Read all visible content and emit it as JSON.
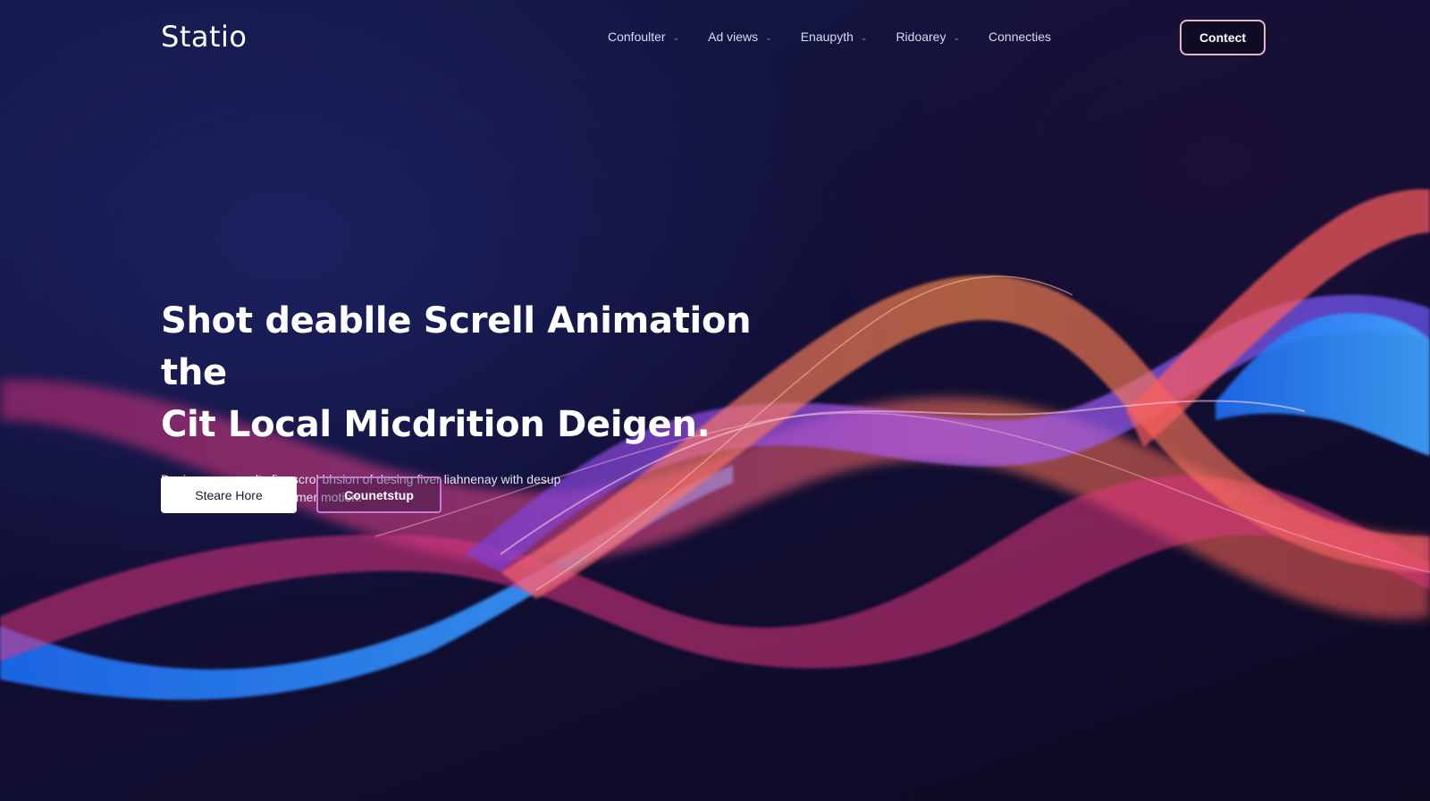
{
  "brand": {
    "logo_text": "Statio"
  },
  "nav": {
    "items": [
      {
        "label": "Confoulter",
        "has_dropdown": true
      },
      {
        "label": "Ad views",
        "has_dropdown": true
      },
      {
        "label": "Enaupyth",
        "has_dropdown": true
      },
      {
        "label": "Ridoarey",
        "has_dropdown": true
      },
      {
        "label": "Connecties",
        "has_dropdown": false
      }
    ],
    "dropdown_glyph": "⌄",
    "contact_label": "Contect"
  },
  "hero": {
    "title_line_1": "Shot deablle Screll Animation the",
    "title_line_2": "Cit Local Micdrition Deigen.",
    "description_line_1": "Designs pecy welty fior scrol bhsion of desing fiver liahnenay with desup",
    "description_line_2": "and dreas and naltby framer motion.",
    "primary_cta": "Steare Hore",
    "secondary_cta": "Counetstup"
  },
  "colors": {
    "background_top": "#141a4a",
    "background_bottom": "#0d0a22",
    "wave_pink": "#e94f9a",
    "wave_orange": "#ff7a45",
    "wave_purple": "#9b5cf6",
    "wave_blue": "#2f8cff",
    "contact_border": "#e8b7c4",
    "secondary_border": "#c77ad8"
  }
}
